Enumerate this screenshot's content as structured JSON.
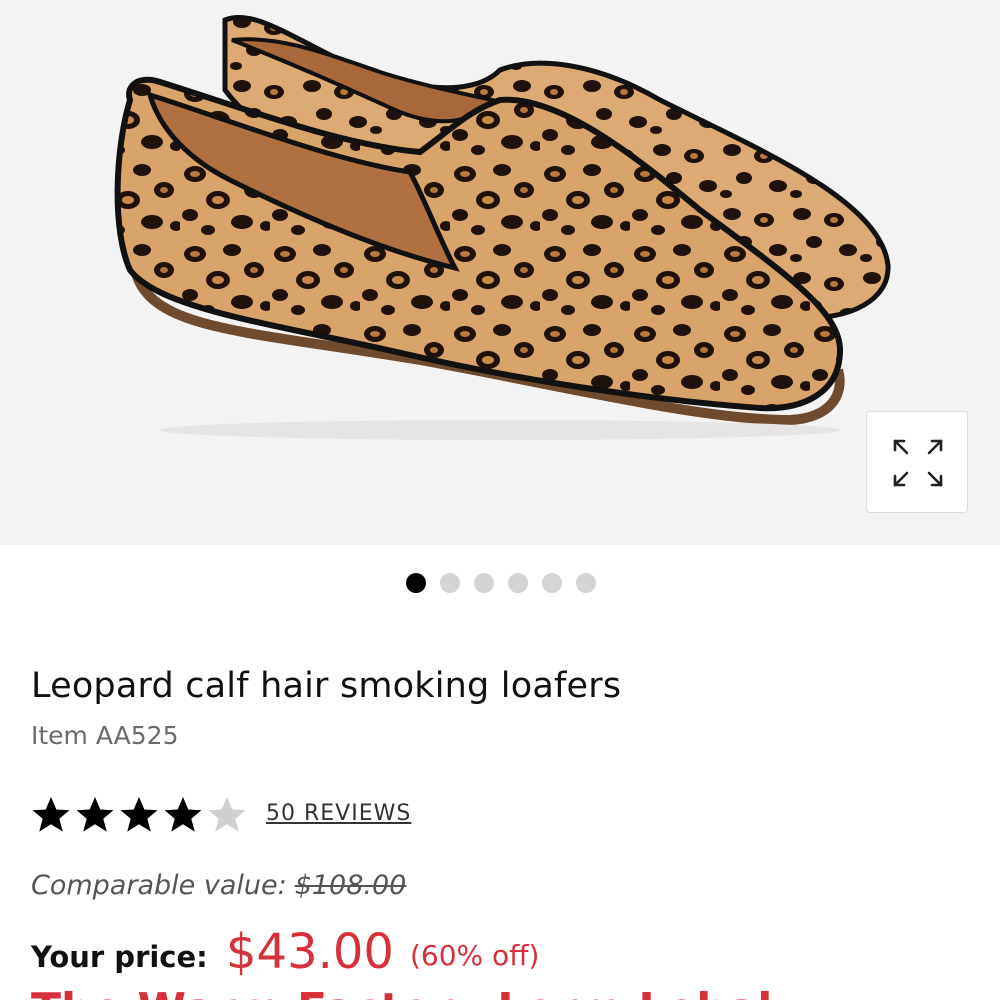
{
  "product": {
    "title": "Leopard calf hair smoking loafers",
    "item": "Item AA525",
    "image_alt": "Leopard print calf hair smoking loafers"
  },
  "gallery": {
    "total_images": 6,
    "active_index": 0,
    "zoom_icon": "expand-arrows-icon"
  },
  "rating": {
    "stars": 4,
    "max_stars": 5,
    "reviews_label": "50 REVIEWS"
  },
  "pricing": {
    "comparable_label": "Comparable value:",
    "comparable_value": "$108.00",
    "your_price_label": "Your price:",
    "price": "$43.00",
    "discount": "(60% off)",
    "promo_partial": "The Warm Factory Lorm Lehal"
  },
  "colors": {
    "price_red": "#d6303a",
    "star_filled": "#000000",
    "star_empty": "#cfcfcf",
    "dot_active": "#000000",
    "dot_inactive": "#d4d4d4"
  }
}
